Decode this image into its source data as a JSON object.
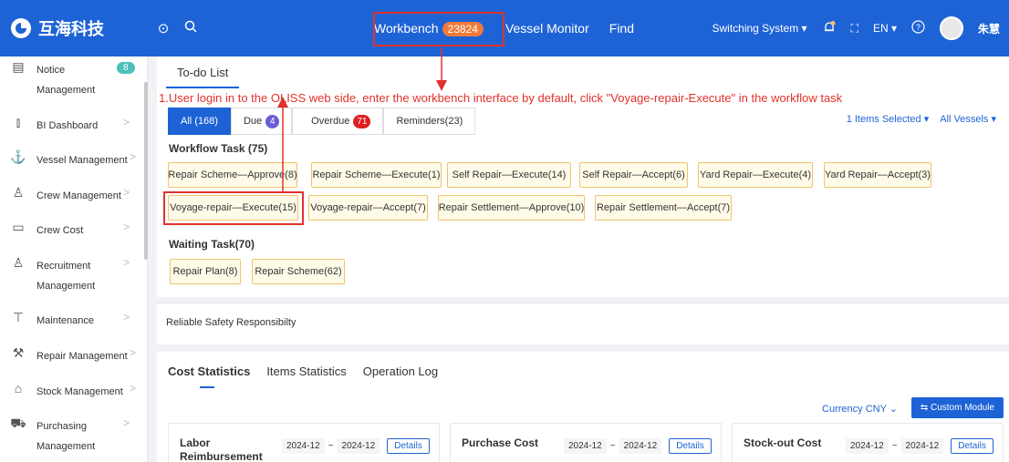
{
  "topbar": {
    "logo_text": "互海科技",
    "nav": {
      "workbench": "Workbench",
      "workbench_count": "23824",
      "vessel_monitor": "Vessel Monitor",
      "find": "Find"
    },
    "switching_system": "Switching System ▾",
    "language": "EN ▾",
    "user_name": "朱慧"
  },
  "sidebar": {
    "notice_badge": "8",
    "items": [
      {
        "label": "Notice",
        "label2": "Management",
        "icon": "notice-icon"
      },
      {
        "label": "BI Dashboard",
        "icon": "chart-icon"
      },
      {
        "label": "Vessel Management",
        "icon": "anchor-icon"
      },
      {
        "label": "Crew Management",
        "icon": "person-icon"
      },
      {
        "label": "Crew Cost",
        "icon": "wallet-icon"
      },
      {
        "label": "Recruitment",
        "label2": "Management",
        "icon": "person-icon"
      },
      {
        "label": "Maintenance",
        "icon": "wrench-icon"
      },
      {
        "label": "Repair Management",
        "icon": "tool-icon"
      },
      {
        "label": "Stock Management",
        "icon": "warehouse-icon"
      },
      {
        "label": "Purchasing",
        "label2": "Management",
        "icon": "cart-icon"
      }
    ]
  },
  "todo": {
    "tab": "To-do List",
    "annotation": "1.User login in to the OLISS web side, enter the workbench interface by default, click \"Voyage-repair-Execute\" in the workflow task",
    "filters": {
      "all": "All (168)",
      "due": "Due",
      "due_count": "4",
      "overdue": "Overdue",
      "overdue_count": "71",
      "reminders": "Reminders(23)"
    },
    "items_selected": "1 Items Selected ▾",
    "all_vessels": "All Vessels ▾",
    "workflow_title": "Workflow Task (75)",
    "workflow_row1": [
      "Repair Scheme—Approve(8)",
      "Repair Scheme—Execute(1)",
      "Self Repair—Execute(14)",
      "Self Repair—Accept(6)",
      "Yard Repair—Execute(4)",
      "Yard Repair—Accept(3)"
    ],
    "workflow_row2": [
      "Voyage-repair—Execute(15)",
      "Voyage-repair—Accept(7)",
      "Repair Settlement—Approve(10)",
      "Repair Settlement—Accept(7)"
    ],
    "waiting_title": "Waiting Task(70)",
    "waiting": [
      "Repair Plan(8)",
      "Repair Scheme(62)"
    ]
  },
  "safety": {
    "label": "Reliable Safety Responsibilty"
  },
  "stats": {
    "tabs": [
      "Cost Statistics",
      "Items Statistics",
      "Operation Log"
    ],
    "currency": "Currency CNY ⌄",
    "custom_module": "⇆ Custom Module",
    "cards": [
      {
        "title": "Labor Reimbursement",
        "from": "2024-12",
        "to": "2024-12",
        "details": "Details"
      },
      {
        "title": "Purchase Cost",
        "from": "2024-12",
        "to": "2024-12",
        "details": "Details"
      },
      {
        "title": "Stock-out Cost",
        "from": "2024-12",
        "to": "2024-12",
        "details": "Details"
      }
    ],
    "range_sep": "~"
  },
  "colors": {
    "primary": "#1e63d6",
    "annotation": "#e0322b",
    "chip_border": "#f0c36d",
    "badge_orange": "#f07a3a",
    "badge_purple": "#6a5ed6",
    "badge_red": "#e02020"
  }
}
